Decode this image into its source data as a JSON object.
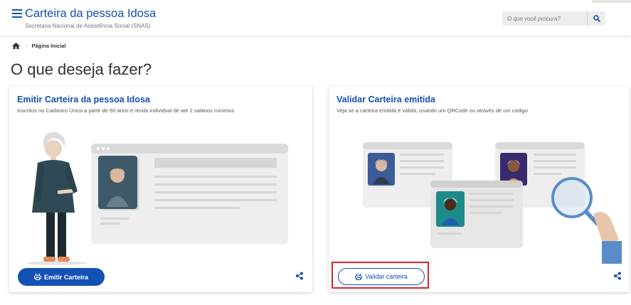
{
  "header": {
    "title": "Carteira da pessoa Idosa",
    "subtitle": "Secretaria Nacional de Assistência Social (SNAS)",
    "search_placeholder": "O que você procura?"
  },
  "breadcrumb": {
    "home_icon": "home-icon",
    "current": "Página Inicial"
  },
  "page_title": "O que deseja fazer?",
  "cards": [
    {
      "title": "Emitir Carteira da pessoa Idosa",
      "description": "Inscritos no Cadastro Único a partir de 60 anos e renda individual de até 2 salários mínimos",
      "button_label": "Emitir Carteira",
      "button_icon": "print-icon",
      "share_icon": "share-icon"
    },
    {
      "title": "Validar Carteira emitida",
      "description": "Veja se a carteira emitida é válida, usando um QRCode ou através de um código",
      "button_label": "Validar carteira",
      "button_icon": "print-icon",
      "share_icon": "share-icon"
    }
  ],
  "colors": {
    "primary": "#1351b4",
    "highlight": "#e0242b"
  }
}
